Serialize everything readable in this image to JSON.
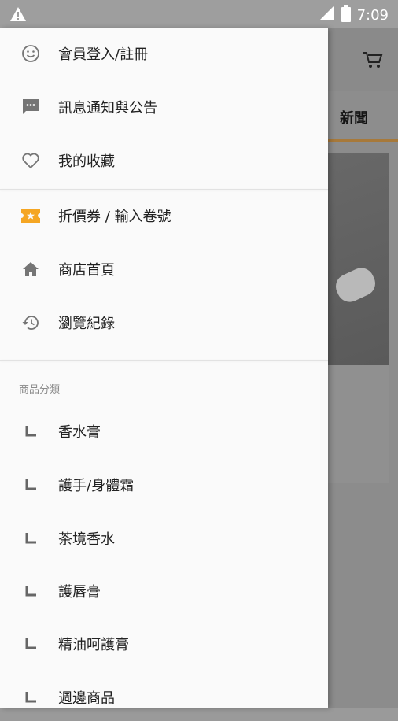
{
  "status_bar": {
    "time": "7:09",
    "icons": [
      "warning-icon",
      "signal-icon",
      "battery-icon"
    ]
  },
  "background": {
    "tab_text": "新聞",
    "accent_color": "#a7793a"
  },
  "drawer": {
    "menu": [
      {
        "label": "會員登入/註冊",
        "icon": "smiley-icon"
      },
      {
        "label": "訊息通知與公告",
        "icon": "chat-icon"
      },
      {
        "label": "我的收藏",
        "icon": "heart-icon"
      },
      {
        "label": "折價券 / 輸入卷號",
        "icon": "ticket-icon"
      },
      {
        "label": "商店首頁",
        "icon": "home-icon"
      },
      {
        "label": "瀏覽紀錄",
        "icon": "history-icon"
      }
    ],
    "categories_header": "商品分類",
    "categories": [
      "香水膏",
      "護手/身體霜",
      "茶境香水",
      "護唇膏",
      "精油呵護膏",
      "週邊商品"
    ],
    "ticket_color": "#f5a623"
  }
}
